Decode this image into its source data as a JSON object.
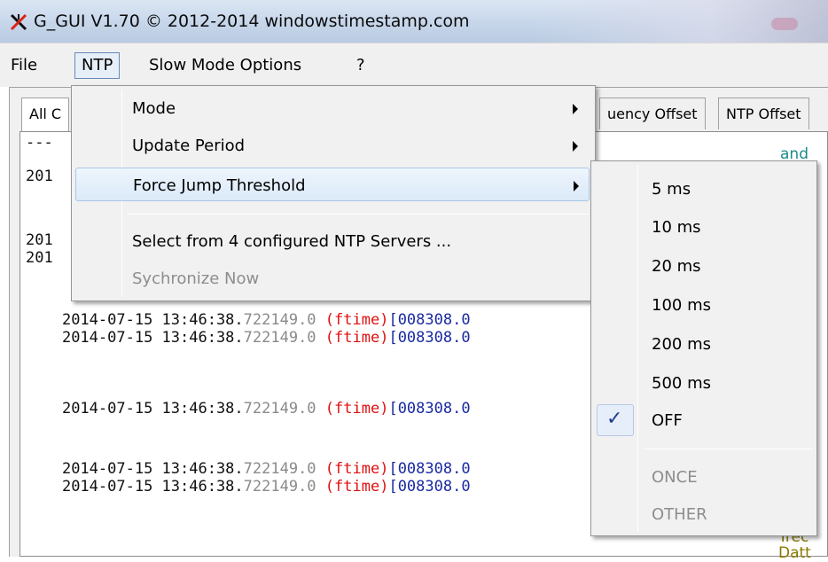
{
  "window": {
    "title": "G_GUI V1.70 © 2012-2014 windowstimestamp.com",
    "icon": "red-black-x-icon"
  },
  "menubar": {
    "items": [
      "File",
      "NTP",
      "Slow Mode Options",
      "?"
    ]
  },
  "tabs": [
    "All C",
    "uency Offset",
    "NTP Offset"
  ],
  "log": {
    "top_partial": "---",
    "lines_partial": [
      "201",
      "201",
      "201"
    ],
    "lines": [
      {
        "date": "2014-07-15 13:46:38.",
        "frac": "722149.0",
        "tag": "(ftime)",
        "bracket": "[008308.0"
      },
      {
        "date": "2014-07-15 13:46:38.",
        "frac": "722149.0",
        "tag": "(ftime)",
        "bracket": "[008308.0"
      },
      {
        "date": "2014-07-15 13:46:38.",
        "frac": "722149.0",
        "tag": "(ftime)",
        "bracket": "[008308.0"
      },
      {
        "date": "2014-07-15 13:46:38.",
        "frac": "722149.0",
        "tag": "(ftime)",
        "bracket": "[008308.0"
      },
      {
        "date": "2014-07-15 13:46:38.",
        "frac": "722149.0",
        "tag": "(ftime)",
        "bracket": "[008308.0"
      }
    ],
    "right_fragments": [
      "and",
      "Trec",
      "Datt"
    ]
  },
  "ntp_menu": {
    "items": [
      {
        "label": "Mode",
        "submenu": true
      },
      {
        "label": "Update Period",
        "submenu": true
      },
      {
        "label": "Force Jump Threshold",
        "submenu": true
      },
      {
        "label": "Select from 4 configured NTP Servers ...",
        "submenu": false
      },
      {
        "label": "Sychronize Now",
        "submenu": false,
        "disabled": true
      }
    ]
  },
  "threshold_menu": {
    "items": [
      {
        "label": "5 ms"
      },
      {
        "label": "10 ms"
      },
      {
        "label": "20 ms"
      },
      {
        "label": "100 ms"
      },
      {
        "label": "200 ms"
      },
      {
        "label": "500 ms"
      },
      {
        "label": "OFF",
        "checked": true
      },
      {
        "label": "ONCE",
        "disabled": true
      },
      {
        "label": "OTHER",
        "disabled": true
      }
    ],
    "check_glyph": "✓"
  },
  "colors": {
    "ftime": "#e01010",
    "bracket": "#1a2aa0",
    "frac": "#8a8a8a",
    "menu_highlight": "#dbe9f8",
    "check": "#1f3e8c"
  }
}
